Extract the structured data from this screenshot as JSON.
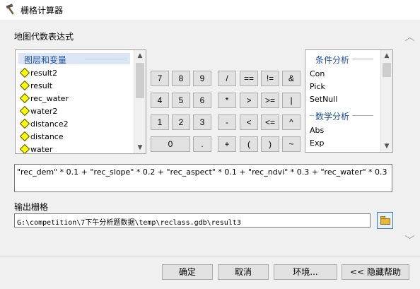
{
  "window": {
    "title": "栅格计算器"
  },
  "map_algebra": {
    "label": "地图代数表达式"
  },
  "layers": {
    "header": "图层和变量",
    "items": [
      "result2",
      "result",
      "rec_water",
      "water2",
      "distance2",
      "distance",
      "water"
    ]
  },
  "calc_buttons": {
    "row1": [
      "7",
      "8",
      "9",
      "/",
      "==",
      "!=",
      "&"
    ],
    "row2": [
      "4",
      "5",
      "6",
      "*",
      ">",
      ">=",
      "|"
    ],
    "row3": [
      "1",
      "2",
      "3",
      "-",
      "<",
      "<=",
      "^"
    ],
    "row4": [
      "0",
      ".",
      "+",
      "(",
      ")",
      "~"
    ]
  },
  "functions": {
    "conditional_header": "条件分析",
    "conditional_items": [
      "Con",
      "Pick",
      "SetNull"
    ],
    "math_header": "数学分析",
    "math_items": [
      "Abs",
      "Exp"
    ]
  },
  "expression": {
    "value": "\"rec_dem\" * 0.1 + \"rec_slope\" * 0.2 + \"rec_aspect\" * 0.1 + \"rec_ndvi\" * 0.3 + \"rec_water\" * 0.3"
  },
  "output": {
    "label": "输出栅格",
    "value": "G:\\competition\\7下午分析题数据\\temp\\reclass.gdb\\result3"
  },
  "buttons": {
    "ok": "确定",
    "cancel": "取消",
    "env": "环境...",
    "hide_help": "<< 隐藏帮助"
  }
}
